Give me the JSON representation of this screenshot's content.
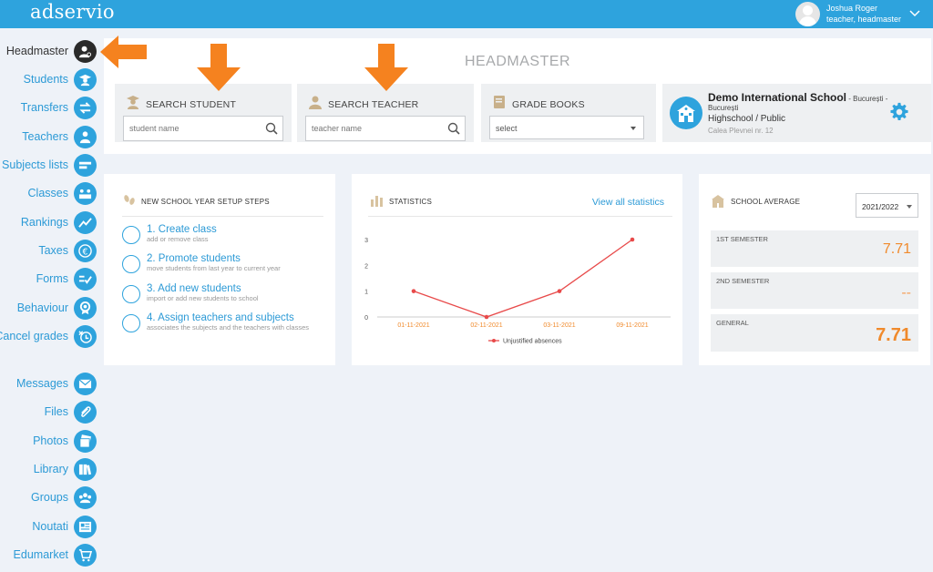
{
  "app": {
    "logo_text": "adservio"
  },
  "user": {
    "name": "Joshua Roger",
    "role": "teacher, headmaster"
  },
  "sidebar": {
    "items": [
      {
        "label": "Headmaster",
        "icon": "headmaster-icon",
        "active": true
      },
      {
        "label": "Students",
        "icon": "graduate-icon"
      },
      {
        "label": "Transfers",
        "icon": "transfer-arrows-icon"
      },
      {
        "label": "Teachers",
        "icon": "teacher-icon"
      },
      {
        "label": "Subjects lists",
        "icon": "list-icon"
      },
      {
        "label": "Classes",
        "icon": "classroom-icon"
      },
      {
        "label": "Rankings",
        "icon": "trend-icon"
      },
      {
        "label": "Taxes",
        "icon": "euro-icon"
      },
      {
        "label": "Forms",
        "icon": "form-check-icon"
      },
      {
        "label": "Behaviour",
        "icon": "medal-icon"
      },
      {
        "label": "Cancel grades",
        "icon": "cancel-grade-icon"
      },
      {
        "label": "Messages",
        "icon": "envelope-icon"
      },
      {
        "label": "Files",
        "icon": "paperclip-icon"
      },
      {
        "label": "Photos",
        "icon": "photos-icon"
      },
      {
        "label": "Library",
        "icon": "books-icon"
      },
      {
        "label": "Groups",
        "icon": "group-icon"
      },
      {
        "label": "Noutati",
        "icon": "news-icon"
      },
      {
        "label": "Edumarket",
        "icon": "cart-icon"
      }
    ]
  },
  "page": {
    "title": "HEADMASTER"
  },
  "search_student": {
    "title": "SEARCH STUDENT",
    "placeholder": "student name"
  },
  "search_teacher": {
    "title": "SEARCH TEACHER",
    "placeholder": "teacher name"
  },
  "grade_books": {
    "title": "GRADE BOOKS",
    "selected": "select"
  },
  "school": {
    "name": "Demo International School",
    "city_suffix": " - București -",
    "city_line2": "București",
    "type": "Highschool / Public",
    "address": "Calea Plevnei nr. 12"
  },
  "setup_steps": {
    "title": "NEW SCHOOL YEAR SETUP STEPS",
    "steps": [
      {
        "title": "1. Create class",
        "desc": "add or remove class"
      },
      {
        "title": "2. Promote students",
        "desc": "move students from last year to current year"
      },
      {
        "title": "3. Add new students",
        "desc": "import or add new students to school"
      },
      {
        "title": "4. Assign teachers and subjects",
        "desc": "associates the subjects and the teachers with classes"
      }
    ]
  },
  "statistics": {
    "title": "STATISTICS",
    "view_all": "View all statistics",
    "chart_data": {
      "type": "line",
      "x": [
        "01-11-2021",
        "02-11-2021",
        "03-11-2021",
        "09-11-2021"
      ],
      "series": [
        {
          "name": "Unjustified absences",
          "values": [
            1,
            0,
            1,
            3
          ],
          "color": "#e84a4a"
        }
      ],
      "y_ticks": [
        0,
        1,
        2,
        3
      ],
      "ylim": [
        0,
        3
      ],
      "grid": false,
      "legend": "bottom"
    }
  },
  "school_average": {
    "title": "SCHOOL AVERAGE",
    "year": "2021/2022",
    "rows": [
      {
        "label": "1ST SEMESTER",
        "value": "7.71"
      },
      {
        "label": "2ND SEMESTER",
        "value": "--"
      },
      {
        "label": "GENERAL",
        "value": "7.71"
      }
    ]
  },
  "colors": {
    "accent": "#2ea3dd",
    "orange": "#f08a2c",
    "chart_line": "#e84a4a"
  }
}
